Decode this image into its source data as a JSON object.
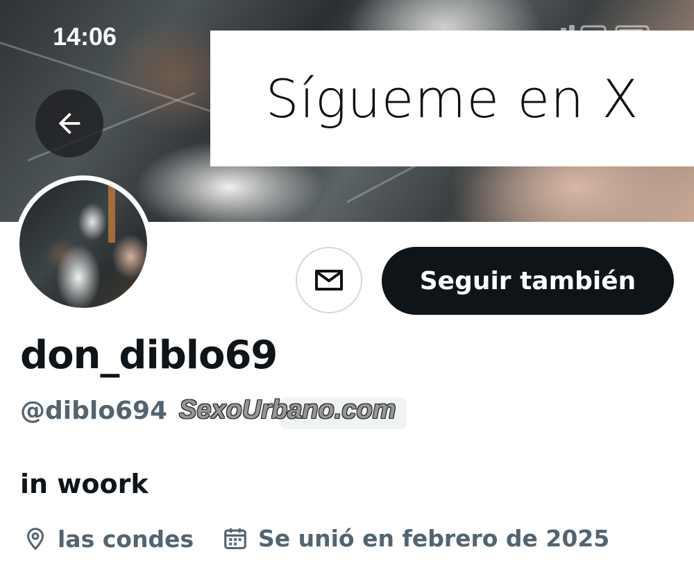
{
  "status_bar": {
    "time": "14:06"
  },
  "banner": {
    "promo_text": "Sígueme en X"
  },
  "nav": {
    "back_icon": "arrow-left-icon"
  },
  "actions": {
    "message_icon": "envelope-icon",
    "follow_label": "Seguir también"
  },
  "profile": {
    "display_name": "don_diblo69",
    "handle": "@diblo694",
    "watermark": "SexoUrbano.com",
    "bio": "in woork",
    "location": "las condes",
    "joined": "Se unió en febrero de 2025"
  },
  "colors": {
    "primary_text": "#0f1419",
    "secondary_text": "#536471",
    "button_dark": "#0f1419"
  }
}
